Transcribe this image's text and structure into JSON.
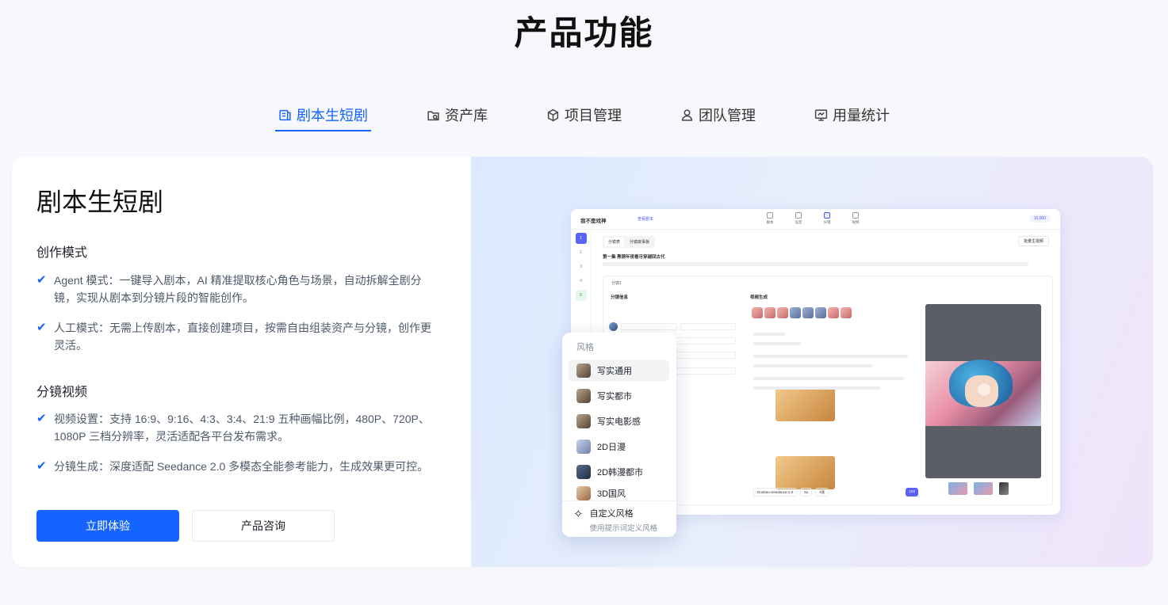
{
  "page_title": "产品功能",
  "tabs": [
    {
      "label": "剧本生短剧",
      "active": true,
      "icon": "script-icon"
    },
    {
      "label": "资产库",
      "active": false,
      "icon": "asset-icon"
    },
    {
      "label": "项目管理",
      "active": false,
      "icon": "cube-icon"
    },
    {
      "label": "团队管理",
      "active": false,
      "icon": "user-icon"
    },
    {
      "label": "用量统计",
      "active": false,
      "icon": "chart-icon"
    }
  ],
  "feature": {
    "title": "剧本生短剧",
    "section1": {
      "title": "创作模式",
      "bullets": [
        "Agent 模式：一键导入剧本，AI 精准提取核心角色与场景，自动拆解全剧分镜，实现从剧本到分镜片段的智能创作。",
        "人工模式：无需上传剧本，直接创建项目，按需自由组装资产与分镜，创作更灵活。"
      ]
    },
    "section2": {
      "title": "分镜视频",
      "bullets": [
        "视频设置：支持 16:9、9:16、4:3、3:4、21:9 五种画幅比例，480P、720P、1080P 三档分辨率，灵活适配各平台发布需求。",
        "分镜生成：深度适配 Seedance 2.0 多模态全能参考能力，生成效果更可控。"
      ]
    },
    "primary_button": "立即体验",
    "secondary_button": "产品咨询"
  },
  "mock": {
    "title": "我不是戏神",
    "link": "查看剧本",
    "steps": [
      "剧本",
      "设定",
      "分镜",
      "视频"
    ],
    "credit": "10,000",
    "tabs": [
      "分镜表",
      "分镜故事板"
    ],
    "batch": "批量生视频",
    "episode_title": "第一集 黑铜年夜看牙穿越回古代",
    "panel_header": "分镜1",
    "info_label": "分镜信息",
    "gen_label": "视频生成",
    "model_chip": "Doubao-Seedance-2.0",
    "duration_chip": "5s",
    "count_chip": "4张",
    "go_chip": "100",
    "sidebar_numbers": [
      "1",
      "2",
      "3",
      "4",
      "5"
    ]
  },
  "style_popup": {
    "title": "风格",
    "items": [
      "写实通用",
      "写实都市",
      "写实电影感",
      "2D日漫",
      "2D韩漫都市",
      "3D国风"
    ],
    "selected": "写实通用",
    "custom_title": "自定义风格",
    "custom_desc": "使用提示词定义风格"
  },
  "colors": {
    "accent": "#1664ff",
    "mock_accent": "#5a63f5"
  }
}
